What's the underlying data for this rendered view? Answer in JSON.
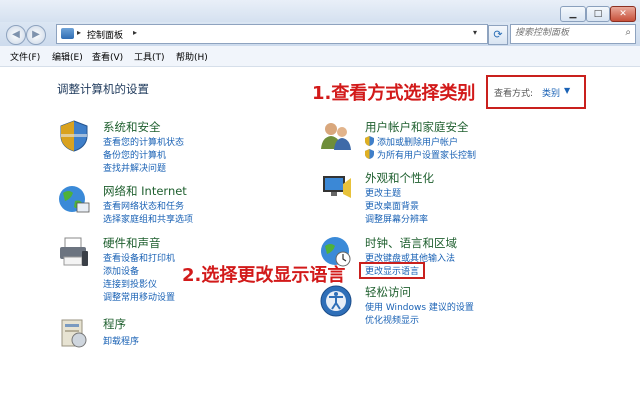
{
  "window": {
    "min_label": "▁",
    "max_label": "□",
    "close_label": "✕"
  },
  "nav": {
    "back_label": "◀",
    "forward_label": "▶",
    "address_crumb": "控制面板",
    "dropdown_glyph": "▾",
    "refresh_glyph": "⟳",
    "search_placeholder": "搜索控制面板"
  },
  "menu": [
    "文件(F)",
    "编辑(E)",
    "查看(V)",
    "工具(T)",
    "帮助(H)"
  ],
  "page_title": "调整计算机的设置",
  "view_by": {
    "label": "查看方式:",
    "value": "类别"
  },
  "annotations": {
    "step1": "1.查看方式选择类别",
    "step2": "2.选择更改显示语言"
  },
  "categories": {
    "system": {
      "title": "系统和安全",
      "links": [
        "查看您的计算机状态",
        "备份您的计算机",
        "查找并解决问题"
      ]
    },
    "network": {
      "title": "网络和 Internet",
      "links": [
        "查看网络状态和任务",
        "选择家庭组和共享选项"
      ]
    },
    "hardware": {
      "title": "硬件和声音",
      "links": [
        "查看设备和打印机",
        "添加设备",
        "连接到投影仪",
        "调整常用移动设置"
      ]
    },
    "programs": {
      "title": "程序",
      "links": [
        "卸载程序"
      ]
    },
    "users": {
      "title": "用户帐户和家庭安全",
      "links": [
        "添加或删除用户帐户",
        "为所有用户设置家长控制"
      ]
    },
    "appearance": {
      "title": "外观和个性化",
      "links": [
        "更改主题",
        "更改桌面背景",
        "调整屏幕分辨率"
      ]
    },
    "clock": {
      "title": "时钟、语言和区域",
      "links": [
        "更改键盘或其他输入法",
        "更改显示语言"
      ]
    },
    "ease": {
      "title": "轻松访问",
      "links": [
        "使用 Windows 建议的设置",
        "优化视频显示"
      ]
    }
  },
  "colors": {
    "annotation_red": "#d21a1a",
    "link_blue": "#1a62b5",
    "heading_green": "#1e5f2e"
  }
}
